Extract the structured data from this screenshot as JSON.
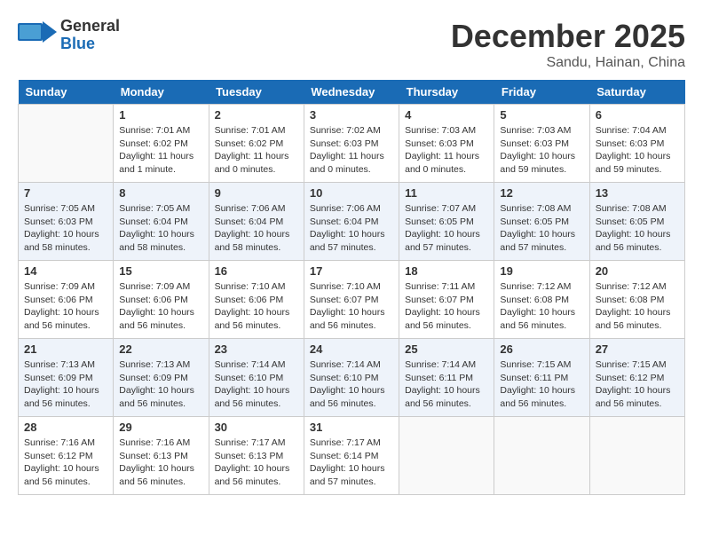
{
  "header": {
    "logo_general": "General",
    "logo_blue": "Blue",
    "month": "December 2025",
    "location": "Sandu, Hainan, China"
  },
  "weekdays": [
    "Sunday",
    "Monday",
    "Tuesday",
    "Wednesday",
    "Thursday",
    "Friday",
    "Saturday"
  ],
  "weeks": [
    [
      {
        "day": "",
        "info": ""
      },
      {
        "day": "1",
        "info": "Sunrise: 7:01 AM\nSunset: 6:02 PM\nDaylight: 11 hours\nand 1 minute."
      },
      {
        "day": "2",
        "info": "Sunrise: 7:01 AM\nSunset: 6:02 PM\nDaylight: 11 hours\nand 0 minutes."
      },
      {
        "day": "3",
        "info": "Sunrise: 7:02 AM\nSunset: 6:03 PM\nDaylight: 11 hours\nand 0 minutes."
      },
      {
        "day": "4",
        "info": "Sunrise: 7:03 AM\nSunset: 6:03 PM\nDaylight: 11 hours\nand 0 minutes."
      },
      {
        "day": "5",
        "info": "Sunrise: 7:03 AM\nSunset: 6:03 PM\nDaylight: 10 hours\nand 59 minutes."
      },
      {
        "day": "6",
        "info": "Sunrise: 7:04 AM\nSunset: 6:03 PM\nDaylight: 10 hours\nand 59 minutes."
      }
    ],
    [
      {
        "day": "7",
        "info": "Sunrise: 7:05 AM\nSunset: 6:03 PM\nDaylight: 10 hours\nand 58 minutes."
      },
      {
        "day": "8",
        "info": "Sunrise: 7:05 AM\nSunset: 6:04 PM\nDaylight: 10 hours\nand 58 minutes."
      },
      {
        "day": "9",
        "info": "Sunrise: 7:06 AM\nSunset: 6:04 PM\nDaylight: 10 hours\nand 58 minutes."
      },
      {
        "day": "10",
        "info": "Sunrise: 7:06 AM\nSunset: 6:04 PM\nDaylight: 10 hours\nand 57 minutes."
      },
      {
        "day": "11",
        "info": "Sunrise: 7:07 AM\nSunset: 6:05 PM\nDaylight: 10 hours\nand 57 minutes."
      },
      {
        "day": "12",
        "info": "Sunrise: 7:08 AM\nSunset: 6:05 PM\nDaylight: 10 hours\nand 57 minutes."
      },
      {
        "day": "13",
        "info": "Sunrise: 7:08 AM\nSunset: 6:05 PM\nDaylight: 10 hours\nand 56 minutes."
      }
    ],
    [
      {
        "day": "14",
        "info": "Sunrise: 7:09 AM\nSunset: 6:06 PM\nDaylight: 10 hours\nand 56 minutes."
      },
      {
        "day": "15",
        "info": "Sunrise: 7:09 AM\nSunset: 6:06 PM\nDaylight: 10 hours\nand 56 minutes."
      },
      {
        "day": "16",
        "info": "Sunrise: 7:10 AM\nSunset: 6:06 PM\nDaylight: 10 hours\nand 56 minutes."
      },
      {
        "day": "17",
        "info": "Sunrise: 7:10 AM\nSunset: 6:07 PM\nDaylight: 10 hours\nand 56 minutes."
      },
      {
        "day": "18",
        "info": "Sunrise: 7:11 AM\nSunset: 6:07 PM\nDaylight: 10 hours\nand 56 minutes."
      },
      {
        "day": "19",
        "info": "Sunrise: 7:12 AM\nSunset: 6:08 PM\nDaylight: 10 hours\nand 56 minutes."
      },
      {
        "day": "20",
        "info": "Sunrise: 7:12 AM\nSunset: 6:08 PM\nDaylight: 10 hours\nand 56 minutes."
      }
    ],
    [
      {
        "day": "21",
        "info": "Sunrise: 7:13 AM\nSunset: 6:09 PM\nDaylight: 10 hours\nand 56 minutes."
      },
      {
        "day": "22",
        "info": "Sunrise: 7:13 AM\nSunset: 6:09 PM\nDaylight: 10 hours\nand 56 minutes."
      },
      {
        "day": "23",
        "info": "Sunrise: 7:14 AM\nSunset: 6:10 PM\nDaylight: 10 hours\nand 56 minutes."
      },
      {
        "day": "24",
        "info": "Sunrise: 7:14 AM\nSunset: 6:10 PM\nDaylight: 10 hours\nand 56 minutes."
      },
      {
        "day": "25",
        "info": "Sunrise: 7:14 AM\nSunset: 6:11 PM\nDaylight: 10 hours\nand 56 minutes."
      },
      {
        "day": "26",
        "info": "Sunrise: 7:15 AM\nSunset: 6:11 PM\nDaylight: 10 hours\nand 56 minutes."
      },
      {
        "day": "27",
        "info": "Sunrise: 7:15 AM\nSunset: 6:12 PM\nDaylight: 10 hours\nand 56 minutes."
      }
    ],
    [
      {
        "day": "28",
        "info": "Sunrise: 7:16 AM\nSunset: 6:12 PM\nDaylight: 10 hours\nand 56 minutes."
      },
      {
        "day": "29",
        "info": "Sunrise: 7:16 AM\nSunset: 6:13 PM\nDaylight: 10 hours\nand 56 minutes."
      },
      {
        "day": "30",
        "info": "Sunrise: 7:17 AM\nSunset: 6:13 PM\nDaylight: 10 hours\nand 56 minutes."
      },
      {
        "day": "31",
        "info": "Sunrise: 7:17 AM\nSunset: 6:14 PM\nDaylight: 10 hours\nand 57 minutes."
      },
      {
        "day": "",
        "info": ""
      },
      {
        "day": "",
        "info": ""
      },
      {
        "day": "",
        "info": ""
      }
    ]
  ]
}
